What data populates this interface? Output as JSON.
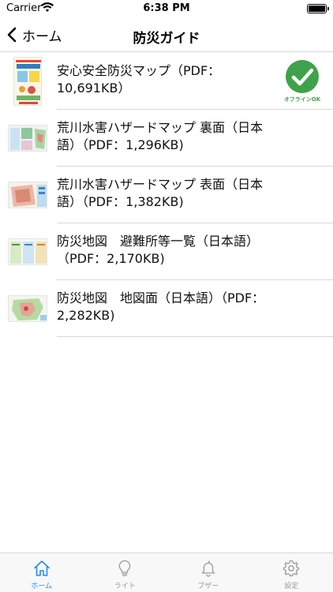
{
  "status_bar": {
    "carrier": "Carrier",
    "time": "6:38 PM"
  },
  "nav": {
    "back_label": "ホーム",
    "title": "防災ガイド"
  },
  "documents": [
    {
      "title": "安心安全防災マップ（PDF：10,691KB）",
      "offline": true,
      "offline_label": "オフラインOK"
    },
    {
      "title": "荒川水害ハザードマップ 裏面（日本語）（PDF：1,296KB)",
      "offline": false
    },
    {
      "title": "荒川水害ハザードマップ 表面（日本語）（PDF：1,382KB)",
      "offline": false
    },
    {
      "title": "防災地図　避難所等一覧（日本語）（PDF：2,170KB)",
      "offline": false
    },
    {
      "title": "防災地図　地図面（日本語）（PDF：2,282KB)",
      "offline": false
    }
  ],
  "tabs": [
    {
      "label": "ホーム",
      "icon": "home-icon",
      "active": true
    },
    {
      "label": "ライト",
      "icon": "lightbulb-icon",
      "active": false
    },
    {
      "label": "ブザー",
      "icon": "bell-icon",
      "active": false
    },
    {
      "label": "設定",
      "icon": "gear-icon",
      "active": false
    }
  ],
  "colors": {
    "accent": "#2b8ae6",
    "offline_green": "#3fa24a",
    "inactive": "#999999"
  }
}
